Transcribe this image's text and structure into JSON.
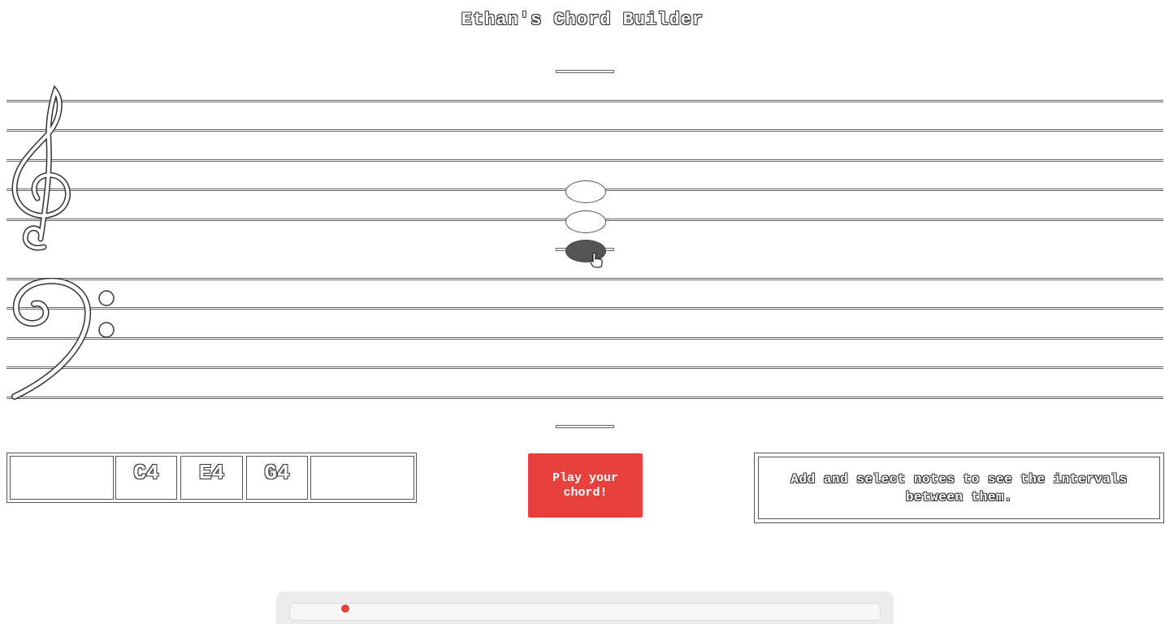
{
  "app": {
    "title": "Ethan's Chord Builder"
  },
  "chord": {
    "slots": [
      "",
      "C4",
      "E4",
      "G4",
      ""
    ],
    "play_label": "Play your chord!"
  },
  "intervals": {
    "message": "Add and select notes to see the intervals between them."
  },
  "colors": {
    "accent": "#e8403d",
    "selected_note": "#555555"
  },
  "icons": [
    "treble-clef-icon",
    "bass-clef-icon",
    "hand-pointer-cursor-icon"
  ]
}
